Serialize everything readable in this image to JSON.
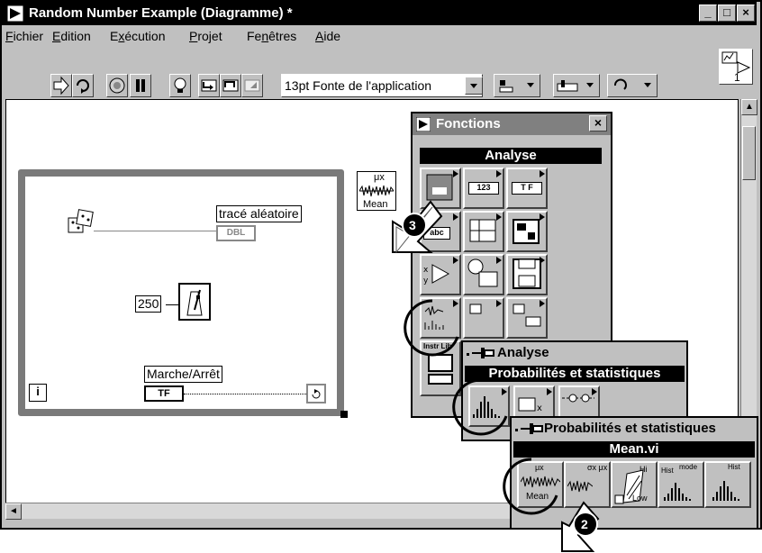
{
  "window": {
    "title": "Random Number Example (Diagramme) *",
    "buttons": [
      "_",
      "□",
      "×"
    ]
  },
  "menu": [
    {
      "u": "F",
      "rest": "ichier"
    },
    {
      "u": "E",
      "rest": "dition"
    },
    {
      "pre": "E",
      "u": "x",
      "rest": "écution"
    },
    {
      "u": "P",
      "rest": "rojet"
    },
    {
      "pre": "Fe",
      "u": "n",
      "rest": "êtres"
    },
    {
      "u": "A",
      "rest": "ide"
    }
  ],
  "toolbar": {
    "font_selector": "13pt Fonte de l'application",
    "connector_pane_number": "1"
  },
  "diagram": {
    "graph_label": "tracé aléatoire",
    "graph_type": "DBL",
    "wait_constant": "250",
    "stop_label": "Marche/Arrêt",
    "stop_type": "TF",
    "iteration_terminal": "i",
    "mean_node_label": "Mean",
    "mean_node_symbol": "μx"
  },
  "functions_palette": {
    "title": "Fonctions",
    "close": "×",
    "header": "Analyse",
    "cells": [
      "",
      "123",
      "T F",
      "abc",
      "",
      "",
      "",
      "",
      "",
      "",
      "",
      "",
      "Instr Lib",
      "",
      ""
    ]
  },
  "analysis_palette": {
    "title": "Analyse",
    "header": "Probabilités et statistiques"
  },
  "stats_palette": {
    "title": "Probabilités et statistiques",
    "header": "Mean.vi",
    "cells": [
      {
        "name": "Mean",
        "sym": "μx"
      },
      {
        "name": "",
        "sym": "σx μx"
      },
      {
        "name": "Low",
        "sym": "Hi"
      },
      {
        "name": "Hist",
        "sym": "mode"
      },
      {
        "name": "",
        "sym": "Hist"
      }
    ]
  },
  "callouts": [
    "3",
    "2"
  ],
  "colors": {
    "title_bg": "#000000",
    "palette_title": "#808080",
    "face": "#c0c0c0",
    "loop": "#7a7a7a"
  }
}
